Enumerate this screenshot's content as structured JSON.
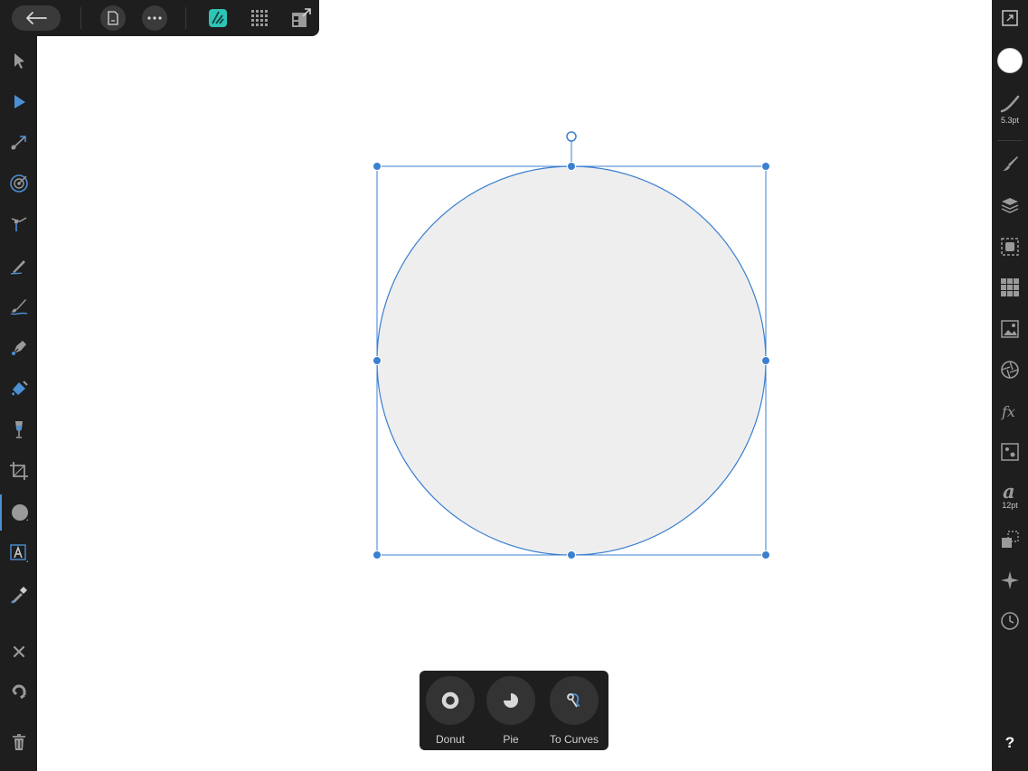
{
  "left_toolbar": {
    "tools": [
      "move-tool",
      "node-tool",
      "corner-tool",
      "point-transform-tool",
      "vector-crop-tool",
      "pencil-tool",
      "vector-brush-tool",
      "pen-tool",
      "fill-tool",
      "transparency-tool",
      "crop-tool",
      "ellipse-tool",
      "text-tool",
      "color-picker-tool"
    ],
    "actions": [
      "close",
      "snapping",
      "delete"
    ]
  },
  "right_toolbar": {
    "stroke_width": "5.3pt",
    "text_size": "12pt",
    "help_label": "?"
  },
  "context_toolbar": {
    "items": [
      {
        "label": "Donut"
      },
      {
        "label": "Pie"
      },
      {
        "label": "To Curves"
      }
    ]
  },
  "colors": {
    "accent": "#3b7fd1",
    "shape_fill": "#eeeeef",
    "teal_persona": "#2ec4b6"
  }
}
